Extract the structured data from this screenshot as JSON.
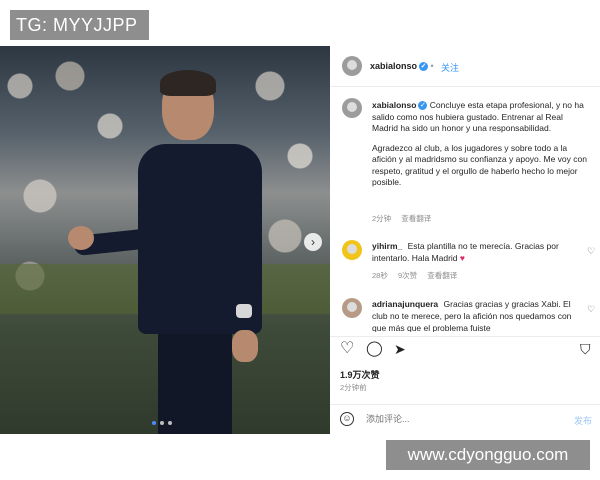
{
  "overlays": {
    "tg_label": "TG: MYYJJPP",
    "site_label": "www.cdyongguo.com"
  },
  "post": {
    "username": "xabialonso",
    "follow_label": "关注",
    "more_icon": "ellipsis-icon",
    "caption_p1": "Concluye esta etapa profesional, y no ha salido como nos hubiera gustado. Entrenar al Real Madrid ha sido un honor y una responsabilidad.",
    "caption_p2": "Agradezco al club, a los jugadores y sobre todo a la afición y al madridsmo su confianza y apoyo. Me voy con respeto, gratitud y el orgullo de haberlo hecho lo mejor posible.",
    "caption_time": "2分钟",
    "caption_translate": "查看翻译",
    "comments": [
      {
        "username": "yihirm_",
        "text": "Esta plantilla no te merecía. Gracias por intentarlo. Hala Madrid",
        "time": "28秒",
        "replies": "9次赞",
        "translate": "查看翻译"
      },
      {
        "username": "adrianajunquera",
        "text": "Gracias gracias y gracias Xabi. El club no te merece, pero la afición nos quedamos con que más que el problema fuiste"
      }
    ],
    "likes": "1.9万次赞",
    "time": "2分钟前",
    "comment_placeholder": "添加评论...",
    "post_button": "发布"
  },
  "colors": {
    "accent": "#3897f0",
    "heart": "#e0245e"
  }
}
